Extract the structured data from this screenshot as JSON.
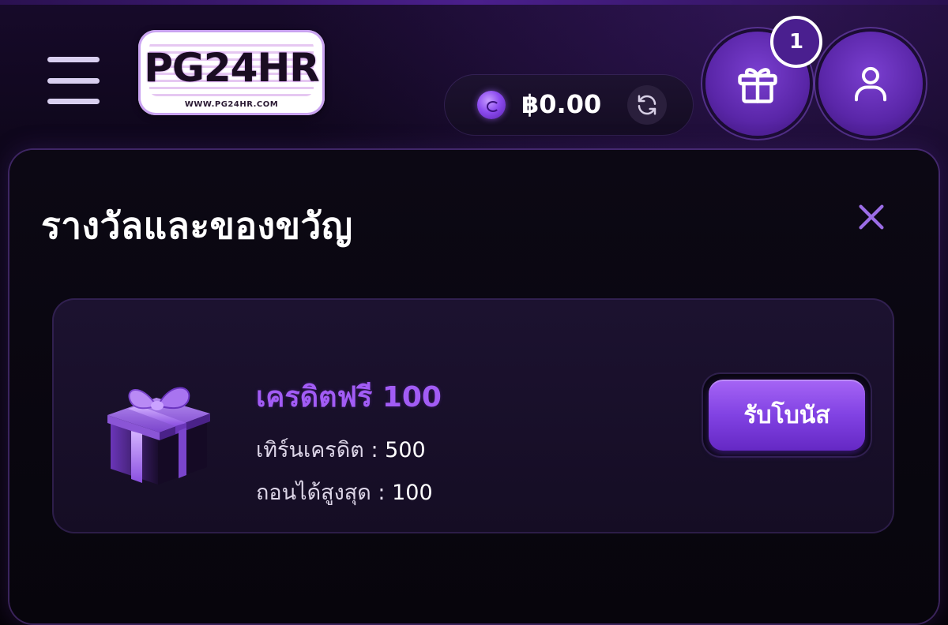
{
  "header": {
    "logo_text": "PG24HR",
    "logo_url": "WWW.PG24HR.COM",
    "balance": "฿0.00",
    "notification_count": "1",
    "icons": {
      "menu": "hamburger-menu-icon",
      "coin": "coin-icon",
      "refresh": "refresh-icon",
      "gift": "gift-icon",
      "profile": "user-icon"
    }
  },
  "modal": {
    "title": "รางวัลและของขวัญ",
    "close_icon": "close-icon",
    "rewards": [
      {
        "title": "เครดิตฟรี 100",
        "turnover_label": "เทิร์นเครดิต",
        "turnover_value": "500",
        "max_withdraw_label": "ถอนได้สูงสุด",
        "max_withdraw_value": "100",
        "claim_label": "รับโบนัส"
      }
    ]
  },
  "colors": {
    "accent": "#8142e3",
    "reward_title": "#a25cf5",
    "background": "#0b0612"
  }
}
